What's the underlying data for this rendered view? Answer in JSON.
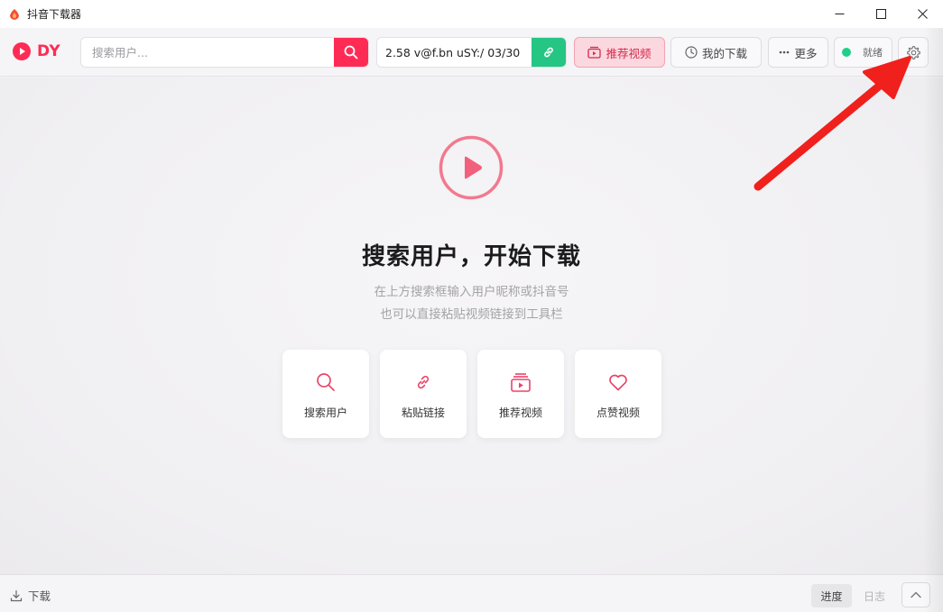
{
  "window": {
    "title": "抖音下载器"
  },
  "toolbar": {
    "logo_text": "DY",
    "search_placeholder": "搜索用户...",
    "link_value": "2.58 v@f.bn uSY:/ 03/30",
    "recommend_label": "推荐视频",
    "downloads_label": "我的下载",
    "more_label": "更多",
    "status_label": "就绪"
  },
  "main": {
    "heading": "搜索用户，开始下载",
    "subtitle_1": "在上方搜索框输入用户昵称或抖音号",
    "subtitle_2": "也可以直接粘贴视频链接到工具栏",
    "cards": [
      {
        "label": "搜索用户",
        "icon": "search-icon"
      },
      {
        "label": "粘贴链接",
        "icon": "link-icon"
      },
      {
        "label": "推荐视频",
        "icon": "video-stack-icon"
      },
      {
        "label": "点赞视频",
        "icon": "heart-icon"
      }
    ]
  },
  "bottom": {
    "download_label": "下载",
    "tab_progress": "进度",
    "tab_log": "日志"
  },
  "colors": {
    "accent": "#fe2c55",
    "link_button": "#25c583",
    "status_ready": "#1fcf88",
    "annotation_arrow": "#f0201c"
  }
}
